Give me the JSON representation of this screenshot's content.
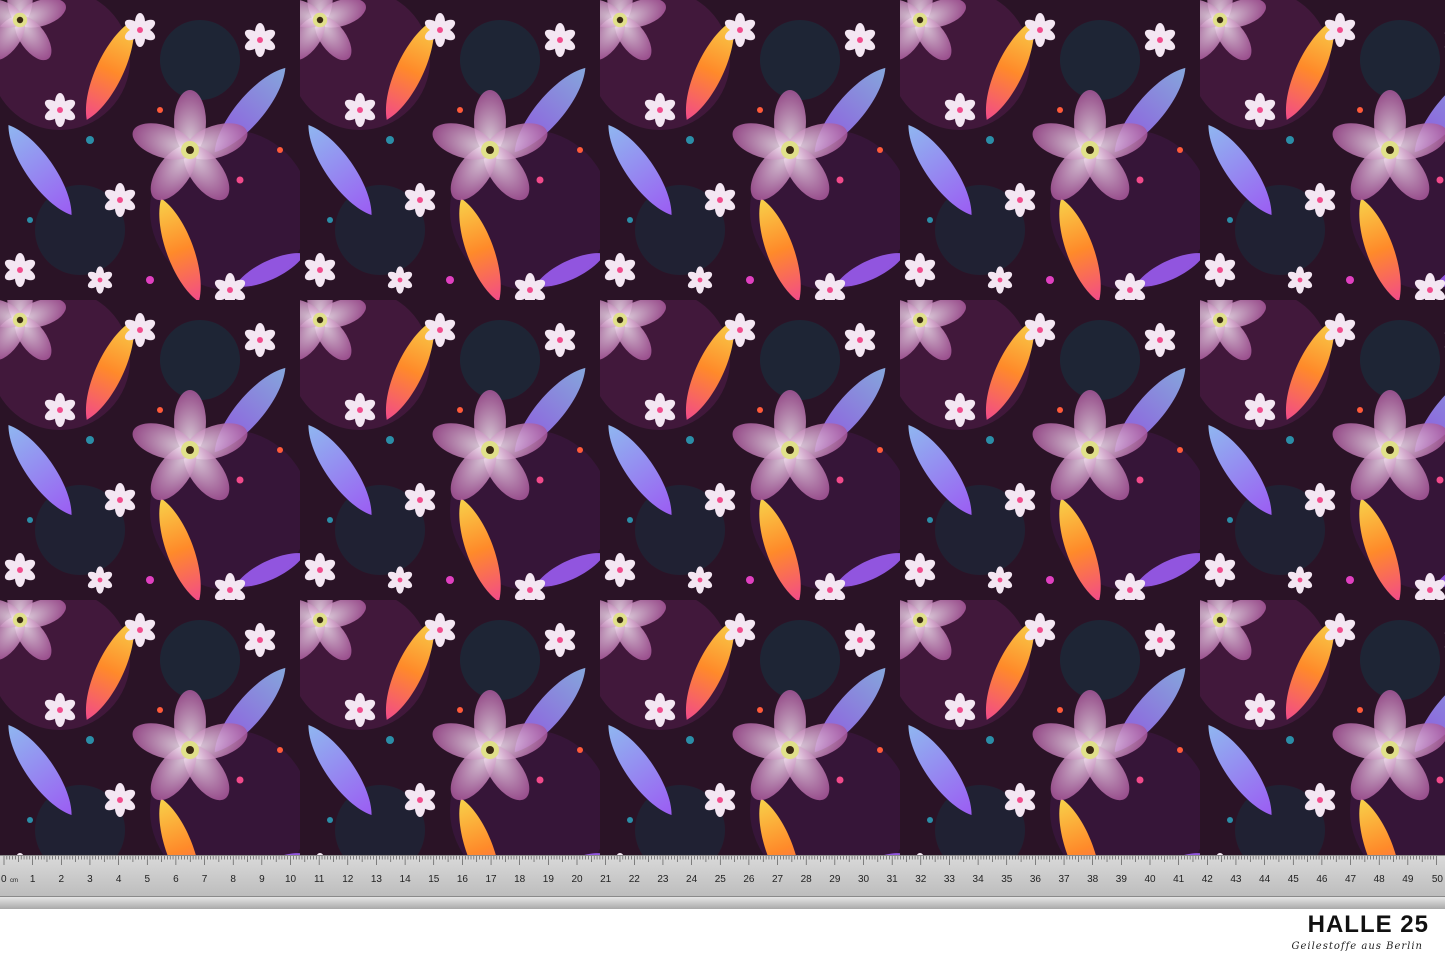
{
  "image": {
    "subject": "fabric-print-sample",
    "palette": [
      "#2a1326",
      "#c97ab8",
      "#9b5cf2",
      "#f24a8a",
      "#ff8a2a",
      "#f7d24a",
      "#8fb7f0",
      "#f4e6f2",
      "#2b8ea8"
    ]
  },
  "ruler": {
    "unit_label": "cm",
    "marks": [
      "0",
      "1",
      "2",
      "3",
      "4",
      "5",
      "6",
      "7",
      "8",
      "9",
      "10",
      "11",
      "12",
      "13",
      "14",
      "15",
      "16",
      "17",
      "18",
      "19",
      "20",
      "21",
      "22",
      "23",
      "24",
      "25",
      "26",
      "27",
      "28",
      "29",
      "30",
      "31",
      "32",
      "33",
      "34",
      "35",
      "36",
      "37",
      "38",
      "39",
      "40",
      "41",
      "42",
      "43",
      "44",
      "45",
      "46",
      "47",
      "48",
      "49",
      "50"
    ]
  },
  "brand": {
    "name": "HALLE 25",
    "tagline": "Geilestoffe aus Berlin"
  }
}
